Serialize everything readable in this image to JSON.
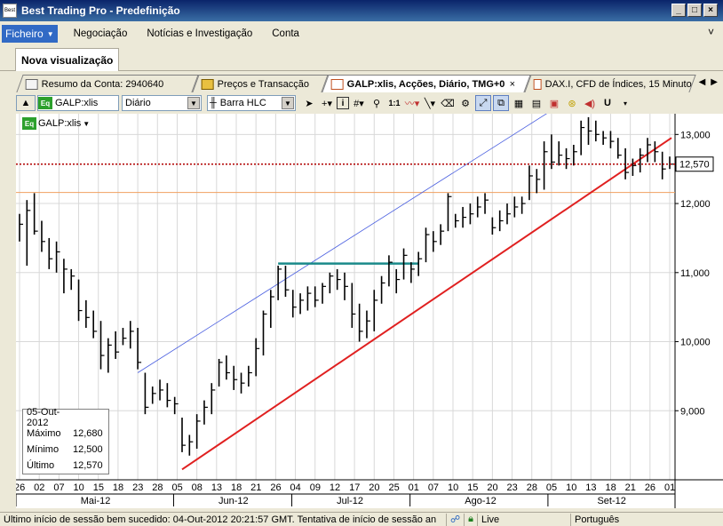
{
  "window": {
    "title": "Best Trading Pro - Predefinição",
    "app_icon_text": "Best",
    "min": "_",
    "max": "□",
    "close": "×"
  },
  "menu": {
    "items": [
      "Ficheiro",
      "Negociação",
      "Notícias e Investigação",
      "Conta"
    ]
  },
  "view_tab": "Nova visualização",
  "doc_tabs": [
    {
      "label": "Resumo da Conta: 2940640"
    },
    {
      "label": "Preços e Transacção"
    },
    {
      "label": "GALP:xlis, Acções, Diário, TMG+0"
    },
    {
      "label": "DAX.I, CFD de Índices, 15 Minuto"
    }
  ],
  "toolbar": {
    "symbol": "GALP:xlis",
    "interval": "Diário",
    "chart_style": "Barra HLC",
    "ratio_label": "1:1"
  },
  "chart_symbol_label": "GALP:xlis",
  "info": {
    "date": "05-Out-2012",
    "rows": [
      {
        "label": "Máximo",
        "value": "12,680"
      },
      {
        "label": "Mínimo",
        "value": "12,500"
      },
      {
        "label": "Último",
        "value": "12,570"
      }
    ]
  },
  "status": {
    "message": "Último início de sessão bem sucedido: 04-Out-2012 20:21:57 GMT. Tentativa de início de sessão an",
    "live": "Live",
    "language": "Português"
  },
  "colors": {
    "support_line": "#e02020",
    "channel_line": "#4a5fe0",
    "resistance_line": "#1a8a8a",
    "last_price_line": "#b00000",
    "orange_line": "#f0a060"
  },
  "chart_data": {
    "type": "bar",
    "style": "HLC",
    "y_ticks": [
      "9,000",
      "10,000",
      "11,000",
      "12,000",
      "13,000"
    ],
    "ylim": [
      8000,
      13300
    ],
    "last_price_label": "12,570",
    "last_price": 12570,
    "orange_level": 12160,
    "x_day_labels": [
      "26",
      "02",
      "07",
      "10",
      "15",
      "18",
      "23",
      "28",
      "05",
      "08",
      "13",
      "18",
      "21",
      "26",
      "04",
      "09",
      "12",
      "17",
      "20",
      "25",
      "01",
      "07",
      "10",
      "15",
      "20",
      "23",
      "28",
      "05",
      "10",
      "13",
      "18",
      "21",
      "26",
      "01"
    ],
    "x_month_labels": [
      "Mai-12",
      "Jun-12",
      "Jul-12",
      "Ago-12",
      "Set-12"
    ],
    "bars": [
      [
        11.85,
        11.45,
        11.7
      ],
      [
        12.05,
        11.1,
        11.9
      ],
      [
        12.15,
        11.55,
        11.6
      ],
      [
        11.75,
        11.3,
        11.45
      ],
      [
        11.5,
        11.05,
        11.2
      ],
      [
        11.45,
        11.0,
        11.3
      ],
      [
        11.2,
        10.7,
        11.05
      ],
      [
        11.05,
        10.75,
        10.95
      ],
      [
        10.9,
        10.3,
        10.45
      ],
      [
        10.6,
        10.2,
        10.35
      ],
      [
        10.45,
        10.05,
        10.15
      ],
      [
        10.3,
        9.6,
        9.8
      ],
      [
        10.05,
        9.55,
        9.95
      ],
      [
        10.15,
        9.75,
        9.85
      ],
      [
        10.2,
        9.95,
        10.05
      ],
      [
        10.3,
        9.9,
        10.15
      ],
      [
        10.2,
        9.6,
        9.7
      ],
      [
        9.55,
        8.95,
        9.05
      ],
      [
        9.35,
        9.1,
        9.25
      ],
      [
        9.45,
        9.15,
        9.3
      ],
      [
        9.4,
        9.05,
        9.15
      ],
      [
        9.2,
        8.95,
        9.1
      ],
      [
        8.9,
        8.4,
        8.5
      ],
      [
        8.65,
        8.35,
        8.55
      ],
      [
        8.95,
        8.45,
        8.85
      ],
      [
        9.15,
        8.8,
        9.05
      ],
      [
        9.4,
        8.95,
        9.3
      ],
      [
        9.75,
        9.35,
        9.7
      ],
      [
        9.8,
        9.45,
        9.55
      ],
      [
        9.65,
        9.3,
        9.45
      ],
      [
        9.55,
        9.25,
        9.4
      ],
      [
        9.65,
        9.35,
        9.55
      ],
      [
        10.05,
        9.5,
        9.9
      ],
      [
        10.45,
        9.8,
        10.4
      ],
      [
        10.75,
        10.2,
        10.65
      ],
      [
        11.1,
        10.6,
        11.05
      ],
      [
        11.1,
        10.65,
        10.75
      ],
      [
        10.75,
        10.35,
        10.5
      ],
      [
        10.7,
        10.4,
        10.6
      ],
      [
        10.8,
        10.45,
        10.7
      ],
      [
        10.8,
        10.5,
        10.6
      ],
      [
        10.85,
        10.55,
        10.8
      ],
      [
        11.0,
        10.7,
        10.95
      ],
      [
        11.05,
        10.75,
        10.9
      ],
      [
        11.0,
        10.6,
        10.8
      ],
      [
        10.85,
        10.2,
        10.4
      ],
      [
        10.55,
        10.0,
        10.15
      ],
      [
        10.45,
        10.05,
        10.3
      ],
      [
        10.75,
        10.15,
        10.6
      ],
      [
        10.95,
        10.55,
        10.85
      ],
      [
        11.25,
        10.8,
        11.15
      ],
      [
        11.05,
        10.7,
        10.9
      ],
      [
        11.35,
        10.9,
        11.25
      ],
      [
        11.15,
        10.85,
        11.05
      ],
      [
        11.3,
        10.95,
        11.2
      ],
      [
        11.65,
        11.15,
        11.55
      ],
      [
        11.6,
        11.3,
        11.45
      ],
      [
        11.7,
        11.4,
        11.6
      ],
      [
        12.15,
        11.6,
        12.1
      ],
      [
        11.85,
        11.65,
        11.75
      ],
      [
        11.95,
        11.65,
        11.8
      ],
      [
        12.0,
        11.7,
        11.85
      ],
      [
        12.1,
        11.8,
        11.95
      ],
      [
        12.15,
        11.85,
        12.05
      ],
      [
        11.8,
        11.55,
        11.65
      ],
      [
        11.9,
        11.6,
        11.75
      ],
      [
        12.0,
        11.7,
        11.85
      ],
      [
        12.1,
        11.8,
        11.95
      ],
      [
        12.1,
        11.85,
        12.0
      ],
      [
        12.55,
        12.05,
        12.4
      ],
      [
        12.5,
        12.15,
        12.35
      ],
      [
        12.9,
        12.2,
        12.75
      ],
      [
        13.0,
        12.5,
        12.6
      ],
      [
        12.9,
        12.55,
        12.7
      ],
      [
        12.8,
        12.5,
        12.65
      ],
      [
        12.85,
        12.55,
        12.75
      ],
      [
        13.2,
        12.7,
        13.1
      ],
      [
        13.25,
        12.85,
        13.05
      ],
      [
        13.2,
        12.9,
        13.0
      ],
      [
        13.05,
        12.85,
        12.95
      ],
      [
        13.05,
        12.8,
        12.9
      ],
      [
        12.95,
        12.65,
        12.7
      ],
      [
        12.8,
        12.35,
        12.45
      ],
      [
        12.65,
        12.4,
        12.55
      ],
      [
        12.8,
        12.45,
        12.7
      ],
      [
        12.95,
        12.6,
        12.85
      ],
      [
        12.9,
        12.6,
        12.75
      ],
      [
        12.75,
        12.35,
        12.5
      ],
      [
        12.68,
        12.5,
        12.57
      ]
    ]
  }
}
